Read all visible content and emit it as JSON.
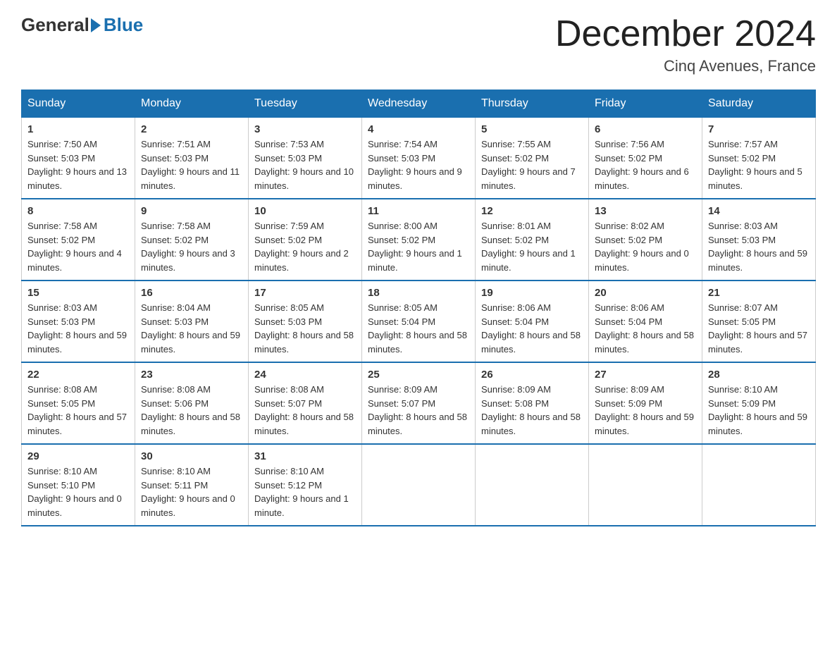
{
  "header": {
    "logo_general": "General",
    "logo_blue": "Blue",
    "month_title": "December 2024",
    "location": "Cinq Avenues, France"
  },
  "days_of_week": [
    "Sunday",
    "Monday",
    "Tuesday",
    "Wednesday",
    "Thursday",
    "Friday",
    "Saturday"
  ],
  "weeks": [
    [
      {
        "day": "1",
        "sunrise": "7:50 AM",
        "sunset": "5:03 PM",
        "daylight": "9 hours and 13 minutes."
      },
      {
        "day": "2",
        "sunrise": "7:51 AM",
        "sunset": "5:03 PM",
        "daylight": "9 hours and 11 minutes."
      },
      {
        "day": "3",
        "sunrise": "7:53 AM",
        "sunset": "5:03 PM",
        "daylight": "9 hours and 10 minutes."
      },
      {
        "day": "4",
        "sunrise": "7:54 AM",
        "sunset": "5:03 PM",
        "daylight": "9 hours and 9 minutes."
      },
      {
        "day": "5",
        "sunrise": "7:55 AM",
        "sunset": "5:02 PM",
        "daylight": "9 hours and 7 minutes."
      },
      {
        "day": "6",
        "sunrise": "7:56 AM",
        "sunset": "5:02 PM",
        "daylight": "9 hours and 6 minutes."
      },
      {
        "day": "7",
        "sunrise": "7:57 AM",
        "sunset": "5:02 PM",
        "daylight": "9 hours and 5 minutes."
      }
    ],
    [
      {
        "day": "8",
        "sunrise": "7:58 AM",
        "sunset": "5:02 PM",
        "daylight": "9 hours and 4 minutes."
      },
      {
        "day": "9",
        "sunrise": "7:58 AM",
        "sunset": "5:02 PM",
        "daylight": "9 hours and 3 minutes."
      },
      {
        "day": "10",
        "sunrise": "7:59 AM",
        "sunset": "5:02 PM",
        "daylight": "9 hours and 2 minutes."
      },
      {
        "day": "11",
        "sunrise": "8:00 AM",
        "sunset": "5:02 PM",
        "daylight": "9 hours and 1 minute."
      },
      {
        "day": "12",
        "sunrise": "8:01 AM",
        "sunset": "5:02 PM",
        "daylight": "9 hours and 1 minute."
      },
      {
        "day": "13",
        "sunrise": "8:02 AM",
        "sunset": "5:02 PM",
        "daylight": "9 hours and 0 minutes."
      },
      {
        "day": "14",
        "sunrise": "8:03 AM",
        "sunset": "5:03 PM",
        "daylight": "8 hours and 59 minutes."
      }
    ],
    [
      {
        "day": "15",
        "sunrise": "8:03 AM",
        "sunset": "5:03 PM",
        "daylight": "8 hours and 59 minutes."
      },
      {
        "day": "16",
        "sunrise": "8:04 AM",
        "sunset": "5:03 PM",
        "daylight": "8 hours and 59 minutes."
      },
      {
        "day": "17",
        "sunrise": "8:05 AM",
        "sunset": "5:03 PM",
        "daylight": "8 hours and 58 minutes."
      },
      {
        "day": "18",
        "sunrise": "8:05 AM",
        "sunset": "5:04 PM",
        "daylight": "8 hours and 58 minutes."
      },
      {
        "day": "19",
        "sunrise": "8:06 AM",
        "sunset": "5:04 PM",
        "daylight": "8 hours and 58 minutes."
      },
      {
        "day": "20",
        "sunrise": "8:06 AM",
        "sunset": "5:04 PM",
        "daylight": "8 hours and 58 minutes."
      },
      {
        "day": "21",
        "sunrise": "8:07 AM",
        "sunset": "5:05 PM",
        "daylight": "8 hours and 57 minutes."
      }
    ],
    [
      {
        "day": "22",
        "sunrise": "8:08 AM",
        "sunset": "5:05 PM",
        "daylight": "8 hours and 57 minutes."
      },
      {
        "day": "23",
        "sunrise": "8:08 AM",
        "sunset": "5:06 PM",
        "daylight": "8 hours and 58 minutes."
      },
      {
        "day": "24",
        "sunrise": "8:08 AM",
        "sunset": "5:07 PM",
        "daylight": "8 hours and 58 minutes."
      },
      {
        "day": "25",
        "sunrise": "8:09 AM",
        "sunset": "5:07 PM",
        "daylight": "8 hours and 58 minutes."
      },
      {
        "day": "26",
        "sunrise": "8:09 AM",
        "sunset": "5:08 PM",
        "daylight": "8 hours and 58 minutes."
      },
      {
        "day": "27",
        "sunrise": "8:09 AM",
        "sunset": "5:09 PM",
        "daylight": "8 hours and 59 minutes."
      },
      {
        "day": "28",
        "sunrise": "8:10 AM",
        "sunset": "5:09 PM",
        "daylight": "8 hours and 59 minutes."
      }
    ],
    [
      {
        "day": "29",
        "sunrise": "8:10 AM",
        "sunset": "5:10 PM",
        "daylight": "9 hours and 0 minutes."
      },
      {
        "day": "30",
        "sunrise": "8:10 AM",
        "sunset": "5:11 PM",
        "daylight": "9 hours and 0 minutes."
      },
      {
        "day": "31",
        "sunrise": "8:10 AM",
        "sunset": "5:12 PM",
        "daylight": "9 hours and 1 minute."
      },
      null,
      null,
      null,
      null
    ]
  ]
}
